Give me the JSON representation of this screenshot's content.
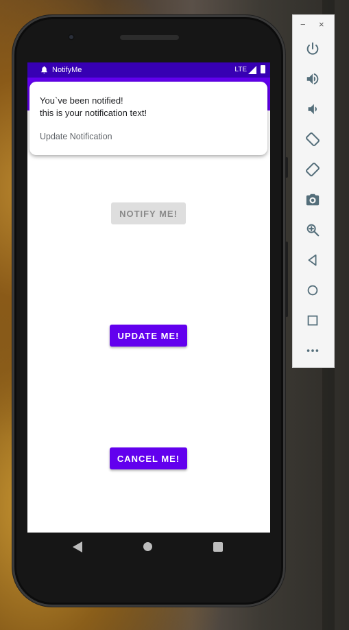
{
  "status_bar": {
    "app_name": "NotifyMe",
    "network": "LTE",
    "color": "#3700b3"
  },
  "notification": {
    "title": "You`ve been notified!",
    "text": "this is your notification text!",
    "action": "Update Notification"
  },
  "buttons": {
    "notify_label": "NOTIFY ME!",
    "notify_enabled": false,
    "update_label": "UPDATE ME!",
    "cancel_label": "CANCEL ME!",
    "primary_color": "#6200ee"
  },
  "nav_bar": {
    "icons": [
      "back-icon",
      "home-icon",
      "recents-icon"
    ]
  },
  "emulator_toolbar": {
    "window_controls": [
      "−",
      "×"
    ],
    "icons": [
      "power-icon",
      "volume-up-icon",
      "volume-down-icon",
      "rotate-left-icon",
      "rotate-right-icon",
      "camera-icon",
      "zoom-icon",
      "back-icon",
      "home-icon",
      "overview-icon",
      "more-icon"
    ]
  }
}
